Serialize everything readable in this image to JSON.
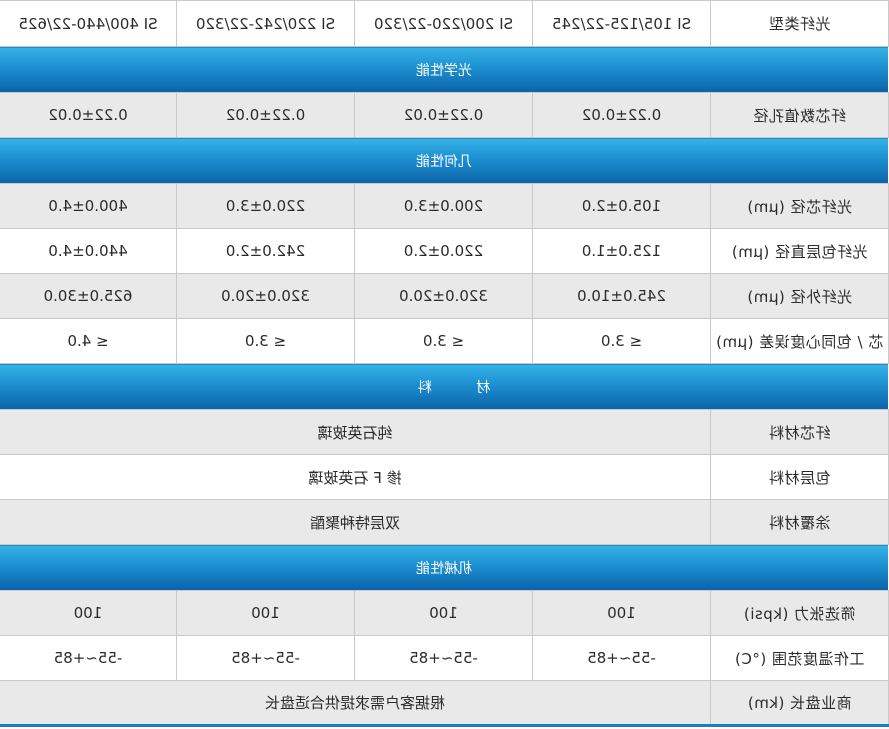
{
  "header": {
    "label": "光纤类型",
    "types": [
      "SI 105/125-22/245",
      "SI 200/220-22/320",
      "SI 220/242-22/320",
      "SI 400/440-22/625"
    ]
  },
  "sections": {
    "optical": "光学性能",
    "geometry": "几何性能",
    "material": "材 料",
    "mechanical": "机械性能"
  },
  "optical_rows": [
    {
      "label": "纤芯数值孔径",
      "values": [
        "0.22±0.02",
        "0.22±0.02",
        "0.22±0.02",
        "0.22±0.02"
      ]
    }
  ],
  "geometry_rows": [
    {
      "label": "光纤芯径 (μm)",
      "values": [
        "105.0±2.0",
        "200.0±3.0",
        "220.0±3.0",
        "400.0±4.0"
      ]
    },
    {
      "label": "光纤包层直径 (μm)",
      "values": [
        "125.0±1.0",
        "220.0±2.0",
        "242.0±2.0",
        "440.0±4.0"
      ]
    },
    {
      "label": "光纤外径 (μm)",
      "values": [
        "245.0±10.0",
        "320.0±20.0",
        "320.0±20.0",
        "625.0±30.0"
      ]
    },
    {
      "label": "芯 / 包同心度误差 (μm)",
      "values": [
        "≤ 3.0",
        "≤ 3.0",
        "≤ 3.0",
        "≤ 4.0"
      ]
    }
  ],
  "material_rows": [
    {
      "label": "纤芯材料",
      "value": "纯石英玻璃"
    },
    {
      "label": "包层材料",
      "value": "掺 F 石英玻璃"
    },
    {
      "label": "涂覆材料",
      "value": "双层特种聚酯"
    }
  ],
  "mechanical_rows": [
    {
      "label": "筛选张力 (kpsi)",
      "values": [
        "100",
        "100",
        "100",
        "100"
      ]
    },
    {
      "label": "工作温度范围 (°C)",
      "values": [
        "-55~+85",
        "-55~+85",
        "-55~+85",
        "-55~+85"
      ]
    }
  ],
  "commercial_row": {
    "label": "商业盘长 (km)",
    "value": "根据客户需求提供合适盘长"
  }
}
